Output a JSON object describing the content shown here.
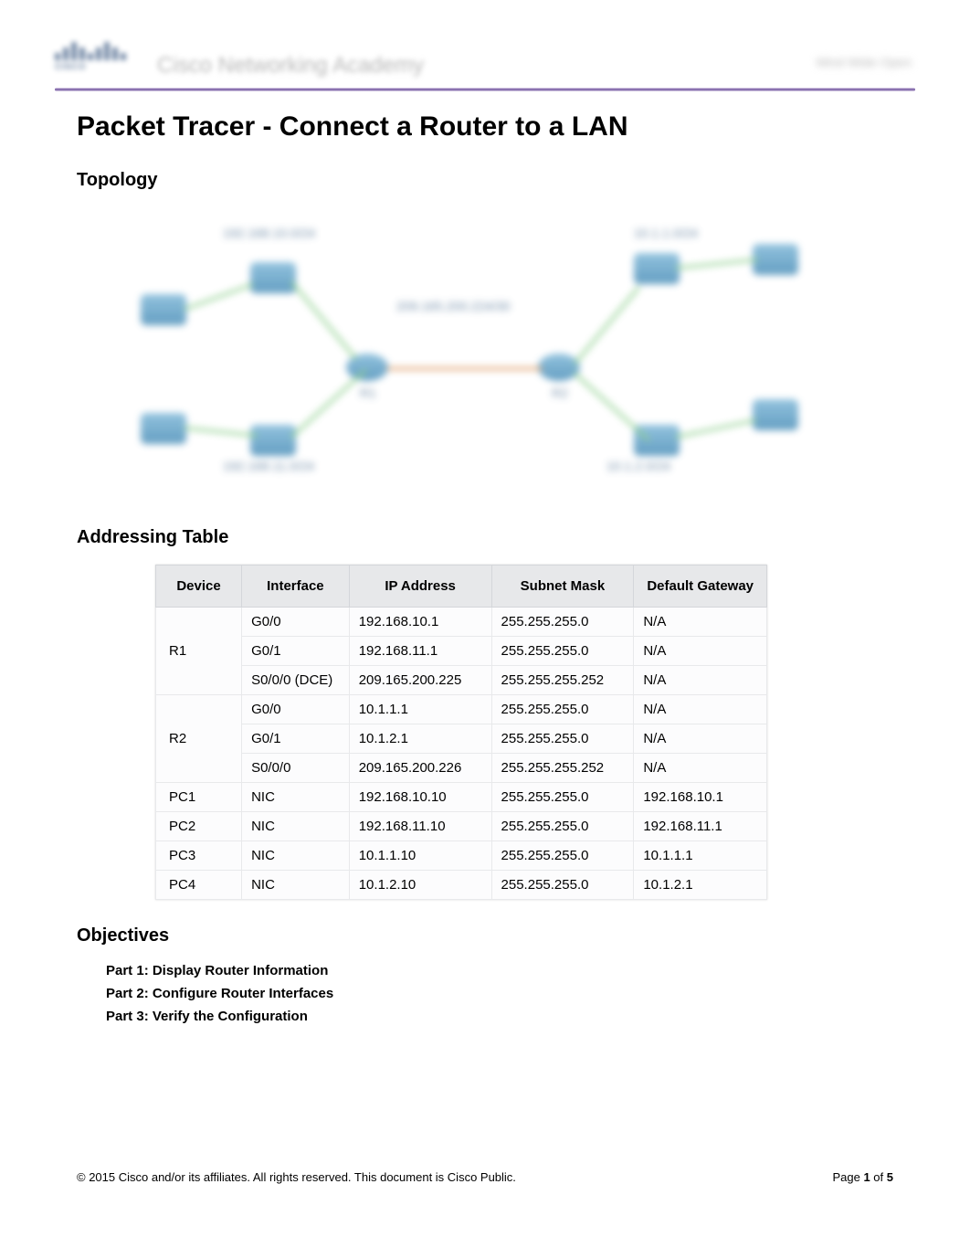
{
  "header": {
    "brand_line1": "CISCO",
    "brand_line2": "Cisco Networking Academy",
    "right_text": "Mind Wide Open"
  },
  "title": "Packet Tracer - Connect a Router to a LAN",
  "sections": {
    "topology": "Topology",
    "addressing": "Addressing Table",
    "objectives": "Objectives"
  },
  "topology": {
    "labels": {
      "top_left": "192.168.10.0/24",
      "top_right": "10.1.1.0/24",
      "center": "209.165.200.224/30",
      "bottom_left": "192.168.11.0/24",
      "bottom_right": "10.1.2.0/24",
      "r1": "R1",
      "r2": "R2"
    }
  },
  "addressing_table": {
    "headers": {
      "device": "Device",
      "interface": "Interface",
      "ip": "IP Address",
      "mask": "Subnet Mask",
      "gateway": "Default Gateway"
    },
    "rows": [
      {
        "device": "R1",
        "rowspan": 3,
        "interface": "G0/0",
        "ip": "192.168.10.1",
        "mask": "255.255.255.0",
        "gateway": "N/A"
      },
      {
        "interface": "G0/1",
        "ip": "192.168.11.1",
        "mask": "255.255.255.0",
        "gateway": "N/A"
      },
      {
        "interface": "S0/0/0 (DCE)",
        "ip": "209.165.200.225",
        "mask": "255.255.255.252",
        "gateway": "N/A"
      },
      {
        "device": "R2",
        "rowspan": 3,
        "interface": "G0/0",
        "ip": "10.1.1.1",
        "mask": "255.255.255.0",
        "gateway": "N/A"
      },
      {
        "interface": "G0/1",
        "ip": "10.1.2.1",
        "mask": "255.255.255.0",
        "gateway": "N/A"
      },
      {
        "interface": "S0/0/0",
        "ip": "209.165.200.226",
        "mask": "255.255.255.252",
        "gateway": "N/A"
      },
      {
        "device": "PC1",
        "rowspan": 1,
        "interface": "NIC",
        "ip": "192.168.10.10",
        "mask": "255.255.255.0",
        "gateway": "192.168.10.1"
      },
      {
        "device": "PC2",
        "rowspan": 1,
        "interface": "NIC",
        "ip": "192.168.11.10",
        "mask": "255.255.255.0",
        "gateway": "192.168.11.1"
      },
      {
        "device": "PC3",
        "rowspan": 1,
        "interface": "NIC",
        "ip": "10.1.1.10",
        "mask": "255.255.255.0",
        "gateway": "10.1.1.1"
      },
      {
        "device": "PC4",
        "rowspan": 1,
        "interface": "NIC",
        "ip": "10.1.2.10",
        "mask": "255.255.255.0",
        "gateway": "10.1.2.1"
      }
    ]
  },
  "objectives": {
    "part1": "Part 1: Display Router Information",
    "part2": "Part 2: Configure Router Interfaces",
    "part3": "Part 3: Verify the Configuration"
  },
  "footer": {
    "copyright": "© 2015 Cisco and/or its affiliates. All rights reserved. This document is Cisco Public.",
    "page_prefix": "Page ",
    "page_current": "1",
    "page_sep": " of ",
    "page_total": "5"
  }
}
